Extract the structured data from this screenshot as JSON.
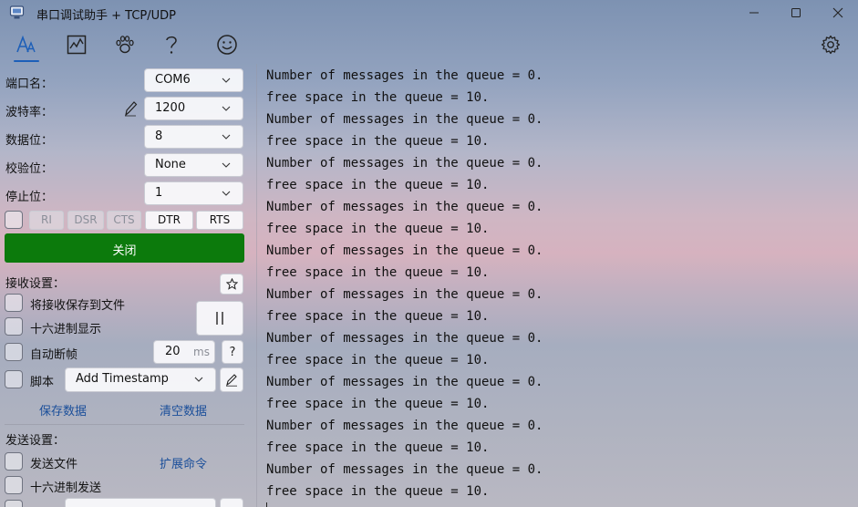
{
  "window": {
    "title": "串口调试助手 + TCP/UDP"
  },
  "toolbar": {
    "icons": [
      "font-icon",
      "chart-icon",
      "paw-icon",
      "help-icon",
      "smiley-icon",
      "gear-icon"
    ]
  },
  "serial": {
    "port_label": "端口名：",
    "port_value": "COM6",
    "baud_label": "波特率：",
    "baud_value": "1200",
    "data_bits_label": "数据位：",
    "data_bits_value": "8",
    "parity_label": "校验位：",
    "parity_value": "None",
    "stop_bits_label": "停止位：",
    "stop_bits_value": "1",
    "pins": [
      "RI",
      "DSR",
      "CTS",
      "DTR",
      "RTS"
    ],
    "close_label": "关闭"
  },
  "receive": {
    "section_label": "接收设置：",
    "save_to_file_label": "将接收保存到文件",
    "hex_display_label": "十六进制显示",
    "auto_frame_label": "自动断帧",
    "auto_frame_value": "20",
    "auto_frame_unit": "ms",
    "help_label": "?",
    "script_label": "脚本",
    "script_value": "Add Timestamp",
    "pause_label": "||",
    "save_data_label": "保存数据",
    "clear_data_label": "清空数据"
  },
  "send": {
    "section_label": "发送设置：",
    "send_file_label": "发送文件",
    "extend_cmd_label": "扩展命令",
    "hex_send_label": "十六进制发送"
  },
  "log": {
    "lines": [
      "Number of messages in the queue = 0.",
      "free space in the queue = 10.",
      "Number of messages in the queue = 0.",
      "free space in the queue = 10.",
      "Number of messages in the queue = 0.",
      "free space in the queue = 10.",
      "Number of messages in the queue = 0.",
      "free space in the queue = 10.",
      "Number of messages in the queue = 0.",
      "free space in the queue = 10.",
      "Number of messages in the queue = 0.",
      "free space in the queue = 10.",
      "Number of messages in the queue = 0.",
      "free space in the queue = 10.",
      "Number of messages in the queue = 0.",
      "free space in the queue = 10.",
      "Number of messages in the queue = 0.",
      "free space in the queue = 10.",
      "Number of messages in the queue = 0.",
      "free space in the queue = 10."
    ]
  },
  "colors": {
    "accent": "#1d5fb8",
    "close_button": "#0c7a0c",
    "link": "#1b4f9a"
  }
}
